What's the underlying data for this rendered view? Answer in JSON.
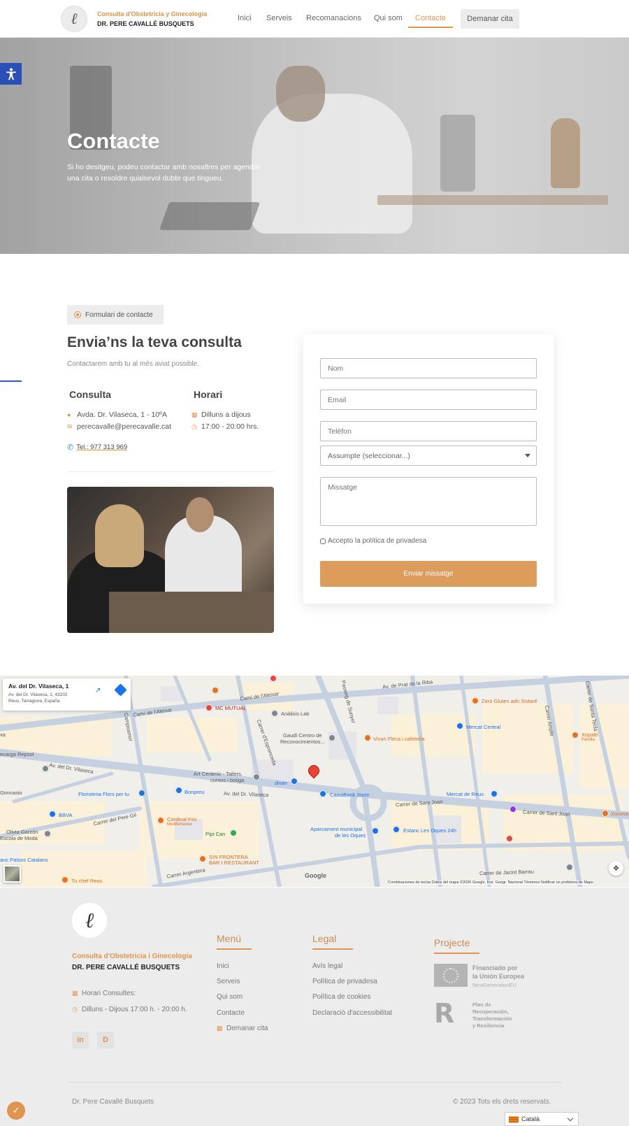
{
  "header": {
    "brand_line1": "Consulta d'Obstetricia y Ginecologia",
    "brand_line2": "DR. PERE CAVALLÉ BUSQUETS",
    "nav": [
      "Inici",
      "Serveis",
      "Recomanacions",
      "Qui som",
      "Contacte"
    ],
    "active_nav": "Contacte",
    "cta": "Demanar cita",
    "accent_color": "#e0954f"
  },
  "hero": {
    "title": "Contacte",
    "subtitle": "Si ho desitgeu, podeu contactar amb nosaltres per agendar una cita o resoldre qualsevol dubte que tingueu."
  },
  "contact": {
    "badge": "Formulari de contacte",
    "title": "Envia’ns la teva consulta",
    "subtitle": "Contactarem amb tu al més aviat possible.",
    "consulta_title": "Consulta",
    "address": "Avda. Dr. Vilaseca, 1 - 10ºA",
    "email": "perecavalle@perecavalle.cat",
    "phone": "Tel.: 977 313 969",
    "horari_title": "Horari",
    "days": "Dilluns a dijous",
    "hours": "17:00 - 20:00 hrs."
  },
  "form": {
    "name_placeholder": "Nom",
    "email_placeholder": "Email",
    "phone_placeholder": "Telèfon",
    "subject_selected": "Assumpte (seleccionar...)",
    "message_placeholder": "Missatge",
    "privacy_label": "Accepto la política de privadesa",
    "submit_label": "Enviar missatge",
    "button_color": "#dc9c5c"
  },
  "map": {
    "place_title": "Av. del Dr. Vilaseca, 1",
    "place_address1": "Av. del Dr. Vilaseca, 1, 43202",
    "place_address2": "Reus, Tarragona, España",
    "labels": {
      "mc_mutual": "MC MUTUAL",
      "cami": "Camí de l'Aleixar",
      "cami2": "Camí de l'Aleixar",
      "analisis": "Anàlisis Lab",
      "gaudi1": "Gaudí Centro de",
      "gaudi2": "Reconocimientos...",
      "vivan": "Vivan Fleca i cafeteria",
      "zero": "Zero Gluten adn Sistaré",
      "mercat_central": "Mercat Central",
      "xopatti": "Xopatti",
      "xopatti_sub": "Parrilla",
      "repsol": "ecarga Repsol",
      "vilaseca1": "Av. del Dr. Vilaseca",
      "vilaseca2": "Av. del Dr. Vilaseca",
      "art1": "Art Ceràmic - Tallers,",
      "art2": "cursos i botiga",
      "divan": "divan",
      "caixabank": "CaixaBank Store",
      "sant_joan1": "Carrer de Sant Joan",
      "sant_joan2": "Carrer de Sant Joan",
      "mercat_reus": "Mercat de Reus",
      "xocosa": "Xocosa",
      "gimnasio": "Gimnasio",
      "floristeria": "Floristeria Flors per tu",
      "bonpreu": "Bonpreu",
      "bbva": "BBVA",
      "carrer_pere": "Carrer del Pere Gil",
      "cardinal1": "Cardinal Fox",
      "cardinal2": "Mediterranea",
      "olivia1": "Olivia Garzón",
      "olivia2": "Escola de Moda",
      "pipi": "Pipi Can",
      "aparc1": "Aparcament municipal",
      "aparc2": "de les Oques",
      "estanc": "Estanc Les Oques 24h",
      "paisos": "anc Països Catalans",
      "sin1": "SIN FRONTERA",
      "sin2": "BAR I RESTAURANT",
      "tu_chef": "Tu chef Reus",
      "argentera": "Carrer Argentera",
      "jacint": "Carrer de Jacint Barrau",
      "prat": "Av. de Prat de la Riba",
      "sunyer": "Passeig de Sunyer",
      "campoamor": "Campoamor",
      "espronceda": "Carrer d'Espronceda",
      "santa_tecla": "Carrer de Santa Tecla",
      "ample": "Carrer Ample",
      "xa": "xa"
    },
    "google": "Google",
    "attribution": "Combinaciones de teclas    Datos del mapa ©2026 Google, Inst. Geogr. Nacional    Términos    Notificar un problema de Maps"
  },
  "footer": {
    "brand1": "Consulta d'Obstetricia i Ginecologia",
    "brand2": "DR. PERE CAVALLÉ BUSQUETS",
    "hours_label": "Horari Consultes:",
    "hours": "Dilluns - Dijous 17:00 h. - 20:00 h.",
    "menu_title": "Menú",
    "menu": [
      "Inici",
      "Serveis",
      "Qui som",
      "Contacte",
      "Demanar cita"
    ],
    "legal_title": "Legal",
    "legal": [
      "Avís legal",
      "Política de privadesa",
      "Política de cookies",
      "Declaració d'accessibilitat"
    ],
    "project_title": "Projecte",
    "eu_line1": "Financiado por",
    "eu_line2": "la Unión Europea",
    "eu_line3": "NextGenerationEU",
    "prtr_line1": "Plan de",
    "prtr_line2": "Recuperación,",
    "prtr_line3": "Transformación",
    "prtr_line4": "y Resiliencia",
    "copyright_left": "Dr. Pere Cavallé Busquets",
    "copyright_right": "© 2023 Tots els drets reservats.",
    "language": "Català"
  }
}
